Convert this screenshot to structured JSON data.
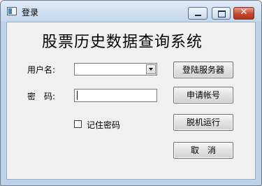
{
  "window": {
    "title": "登录",
    "controls": {
      "minimize_icon": "minimize-icon",
      "maximize_icon": "maximize-icon",
      "close_icon": "close-icon",
      "close_glyph": "✕"
    }
  },
  "form": {
    "heading": "股票历史数据查询系统",
    "username_label": "用户名:",
    "username_value": "",
    "password_label": "密　码:",
    "password_value": "",
    "remember_label": "记住密码",
    "remember_checked": false
  },
  "buttons": {
    "login": "登陆服务器",
    "apply": "申请帐号",
    "offline": "脱机运行",
    "cancel": "取　消"
  }
}
